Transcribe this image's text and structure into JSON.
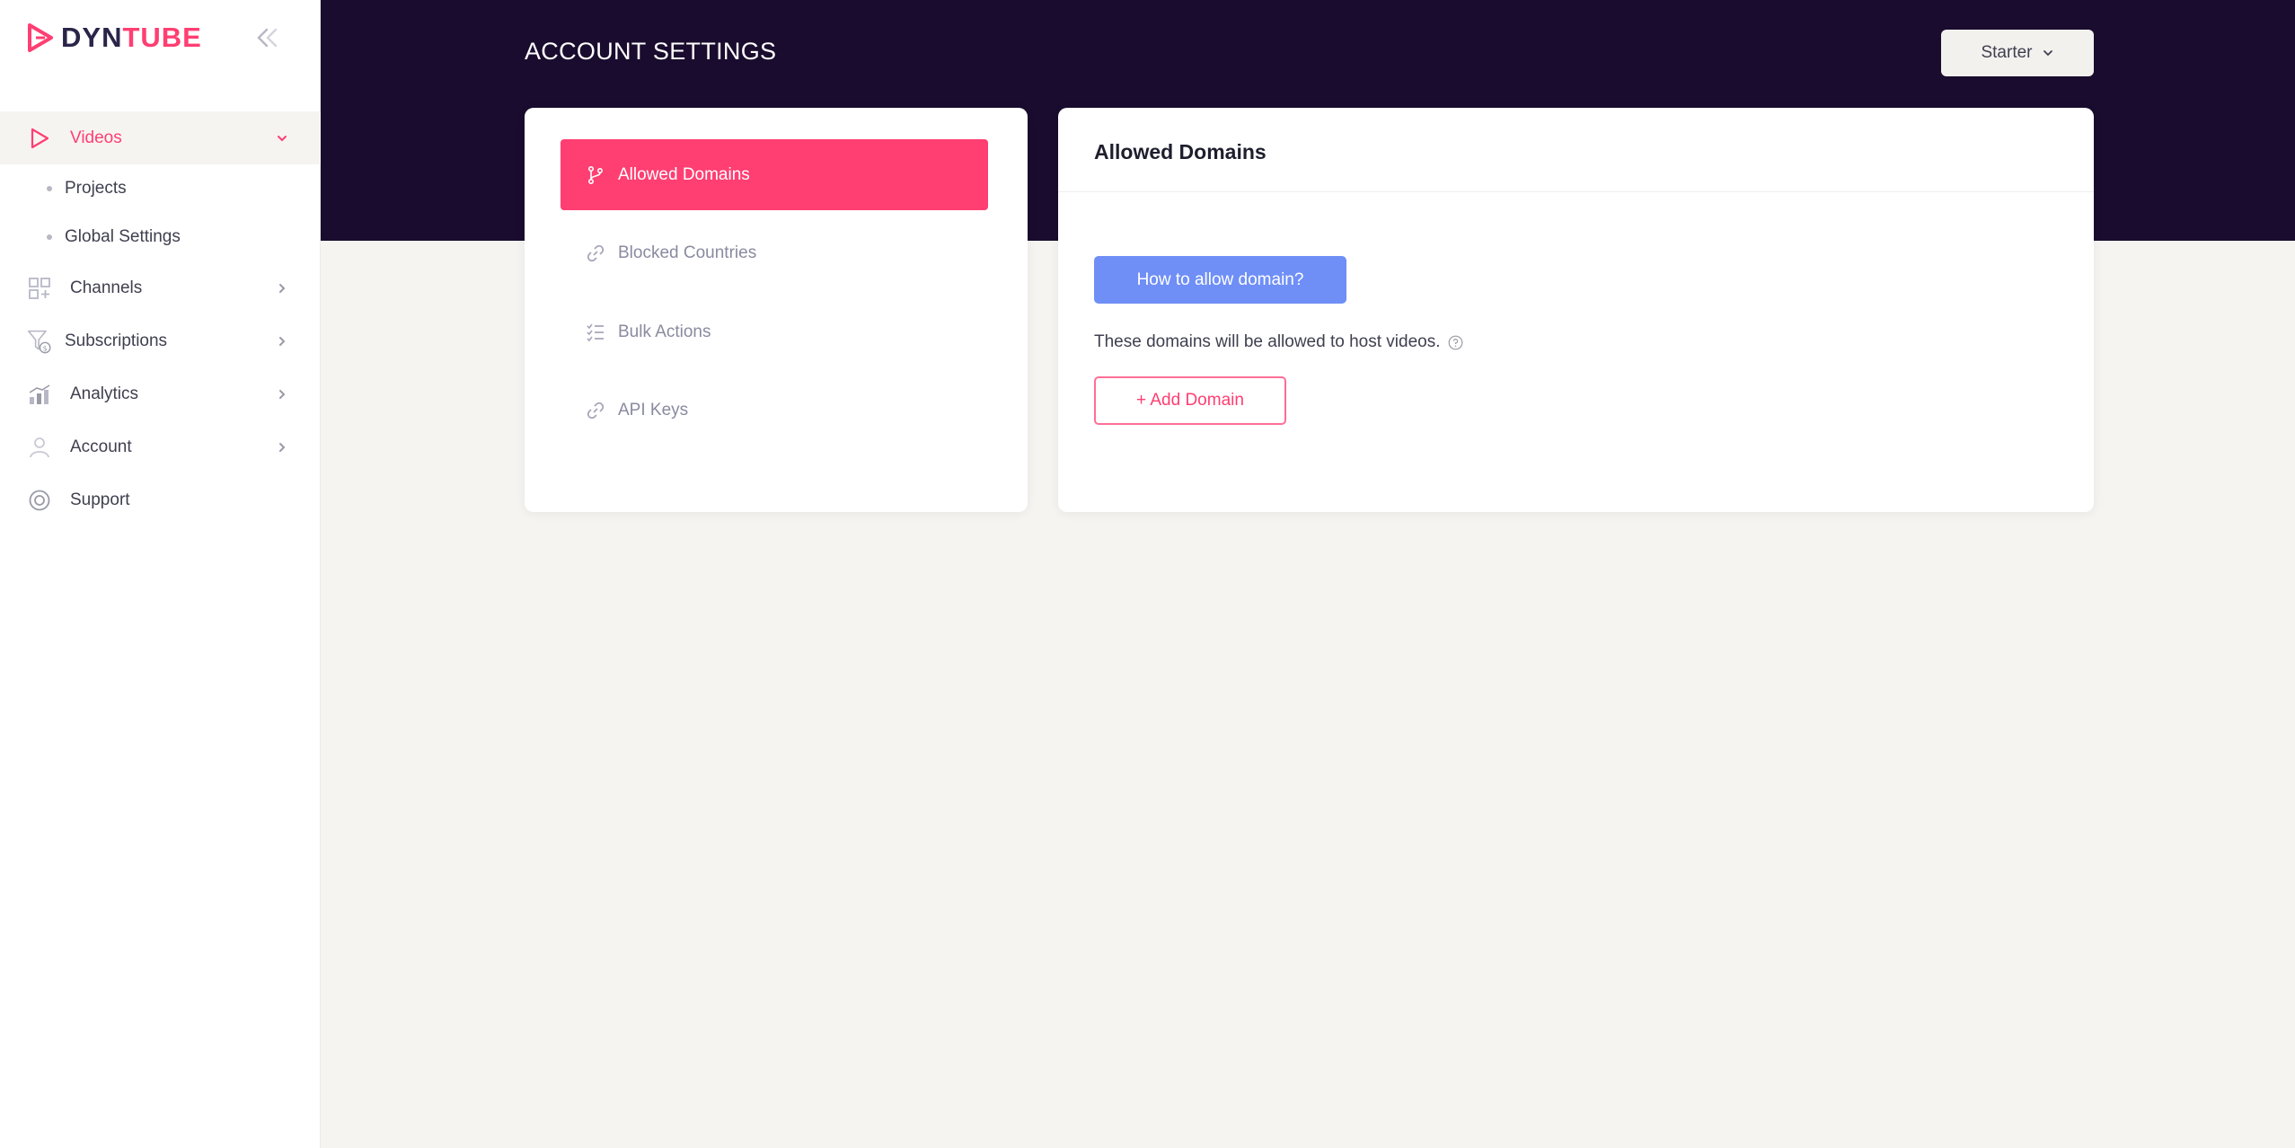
{
  "brand": {
    "logo_part1": "DYN",
    "logo_part2": "TUBE",
    "accent": "#ff3e72",
    "dark": "#1a0c2e"
  },
  "sidebar": {
    "items": [
      {
        "label": "Videos",
        "icon": "play-icon",
        "active": true,
        "expanded": true,
        "children": [
          {
            "label": "Projects"
          },
          {
            "label": "Global Settings"
          }
        ]
      },
      {
        "label": "Channels",
        "icon": "channels-icon"
      },
      {
        "label": "Subscriptions",
        "icon": "subscriptions-icon"
      },
      {
        "label": "Analytics",
        "icon": "analytics-icon"
      },
      {
        "label": "Account",
        "icon": "account-icon"
      },
      {
        "label": "Support",
        "icon": "support-icon"
      }
    ]
  },
  "header": {
    "title": "ACCOUNT SETTINGS",
    "plan_select": "Starter"
  },
  "settings_menu": {
    "items": [
      {
        "label": "Allowed Domains",
        "icon": "branch-icon",
        "active": true
      },
      {
        "label": "Blocked Countries",
        "icon": "link-icon"
      },
      {
        "label": "Bulk Actions",
        "icon": "checklist-icon"
      },
      {
        "label": "API Keys",
        "icon": "link-icon"
      }
    ]
  },
  "content": {
    "title": "Allowed Domains",
    "howto_button": "How to allow domain?",
    "description": "These domains will be allowed to host videos.",
    "add_button": "+ Add Domain",
    "button_color": "#6f8ff7"
  }
}
